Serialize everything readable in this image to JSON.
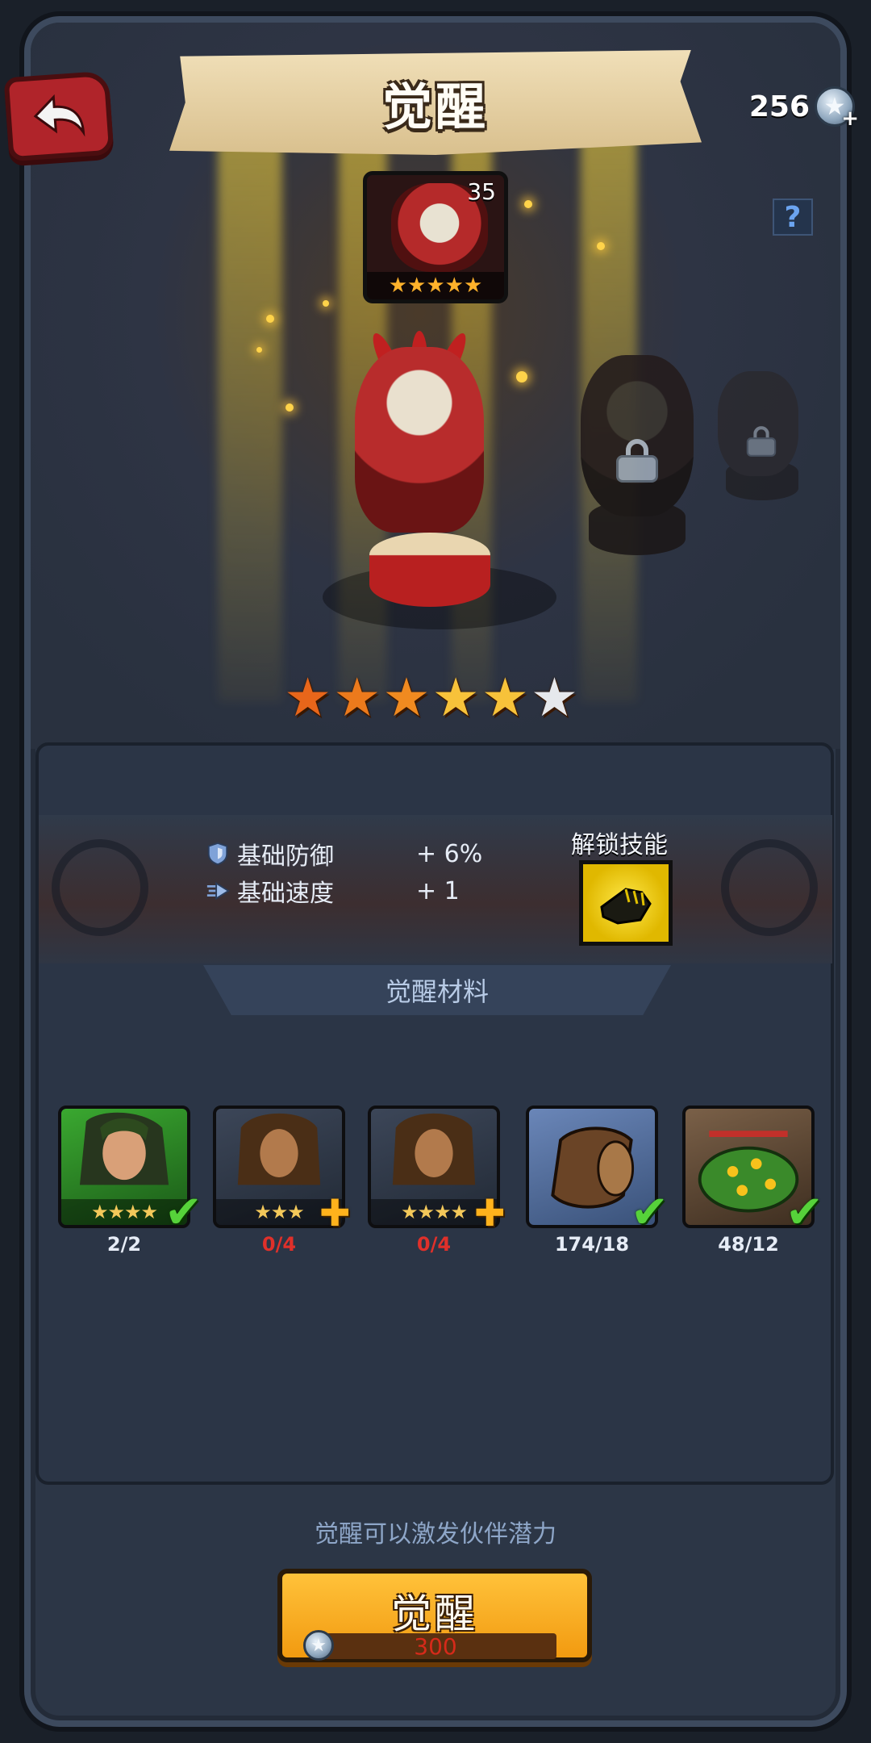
{
  "header": {
    "title": "觉醒",
    "currency_value": "256",
    "help_label": "?"
  },
  "hero": {
    "level": "35",
    "portrait_stars": "★★★★★",
    "awaken_stars_filled": 5,
    "awaken_stars_total": 6
  },
  "stats": {
    "items": [
      {
        "icon": "shield-icon",
        "label": "基础防御",
        "value": "+ 6%"
      },
      {
        "icon": "speed-icon",
        "label": "基础速度",
        "value": "+ 1"
      }
    ],
    "unlock_skill_label": "解锁技能",
    "unlock_skill_icon": "fist-icon"
  },
  "materials": {
    "title": "觉醒材料",
    "items": [
      {
        "name": "green-hair-hero",
        "stars": "★★★★",
        "count": "2/2",
        "status": "complete",
        "count_color": "#e6ecf6"
      },
      {
        "name": "bearded-hero",
        "stars": "★★★",
        "count": "0/4",
        "status": "add",
        "count_color": "#e0302a"
      },
      {
        "name": "bearded-hero",
        "stars": "★★★★",
        "count": "0/4",
        "status": "add",
        "count_color": "#e0302a"
      },
      {
        "name": "wood-log",
        "stars": "",
        "count": "174/18",
        "status": "complete",
        "count_color": "#e6ecf6"
      },
      {
        "name": "flower-bush",
        "stars": "",
        "count": "48/12",
        "status": "complete",
        "count_color": "#e6ecf6"
      }
    ]
  },
  "footer": {
    "hint": "觉醒可以激发伙伴潜力",
    "awaken_button_label": "觉醒",
    "awaken_cost": "300"
  },
  "colors": {
    "accent_orange": "#f29a10",
    "check_green": "#56d23a",
    "insufficient_red": "#e0302a",
    "star_gold": "#ffb22b"
  }
}
